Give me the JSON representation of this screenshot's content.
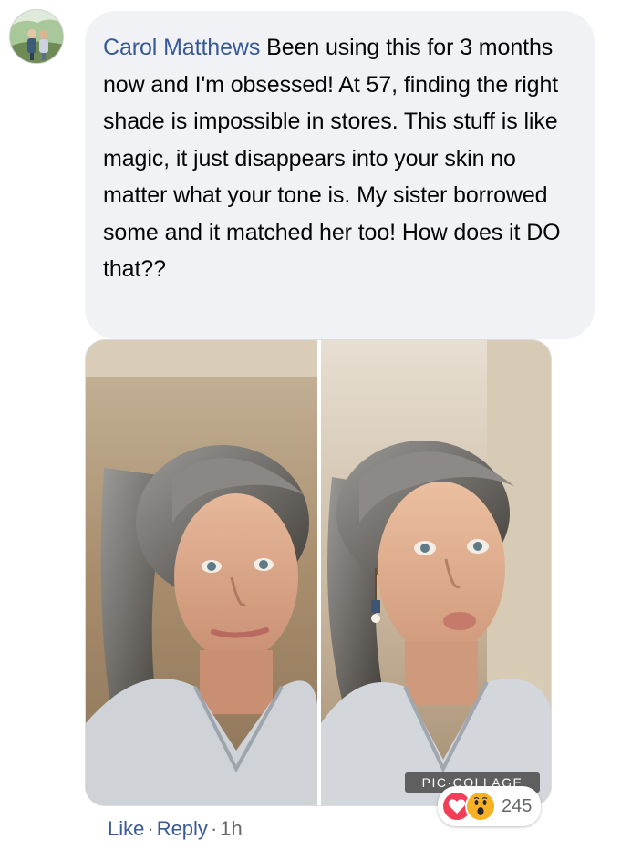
{
  "comment": {
    "author": "Carol Matthews",
    "text": "Been using this for 3 months now and I'm obsessed! At 57, finding the right shade is impossible in stores. This stuff is like magic, it just disappears into your skin no matter what your tone is. My sister borrowed some and it matched her too! How does it DO that??"
  },
  "photo": {
    "watermark": "PIC·COLLAGE"
  },
  "reactions": {
    "icons": [
      "love-icon",
      "wow-icon"
    ],
    "count": "245"
  },
  "actions": {
    "like": "Like",
    "separator": "·",
    "reply": "Reply",
    "time": "1h"
  },
  "colors": {
    "link": "#385898",
    "bubble": "#f0f2f5",
    "text": "#050505",
    "meta": "#65676b",
    "love": "#f33e58",
    "wow": "#f7b125"
  }
}
